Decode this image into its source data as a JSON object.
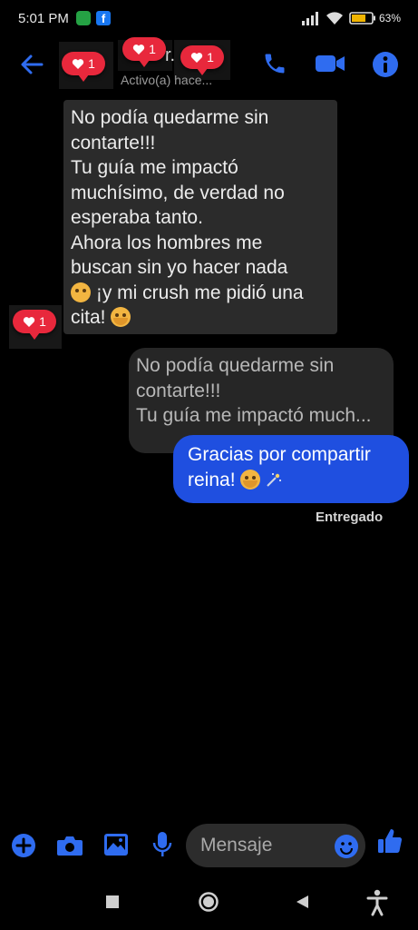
{
  "status_bar": {
    "time": "5:01 PM",
    "battery": "63%",
    "facebook_glyph": "f",
    "icons": [
      "whatsapp-icon",
      "facebook-icon",
      "signal-icon",
      "wifi-icon",
      "battery-icon"
    ]
  },
  "header": {
    "name_fragment": "r.",
    "status_text": "Activo(a) hace...",
    "icons": [
      "back-arrow-icon",
      "phone-icon",
      "video-camera-icon",
      "info-icon"
    ],
    "reaction_badges": [
      "1",
      "1",
      "1"
    ]
  },
  "conversation": {
    "incoming": {
      "lines": [
        "No podía quedarme sin",
        "contarte!!!",
        "Tu guía me impactó",
        "muchísimo, de verdad no",
        "esperaba tanto.",
        "Ahora los hombres me",
        "buscan sin yo hacer nada",
        "¡y mi crush me pidió una",
        "cita!"
      ],
      "reaction_count": "1"
    },
    "reply_quote": {
      "lines": [
        "No podía quedarme sin",
        "contarte!!!",
        "Tu guía me impactó much..."
      ]
    },
    "outgoing": {
      "lines": [
        "Gracias por compartir",
        "reina!"
      ],
      "status": "Entregado"
    }
  },
  "composer": {
    "placeholder": "Mensaje",
    "icons": [
      "plus-icon",
      "camera-icon",
      "image-icon",
      "microphone-icon",
      "emoji-icon",
      "thumbs-up-icon"
    ]
  },
  "nav_bar": {
    "icons": [
      "square-recents-icon",
      "circle-home-icon",
      "triangle-back-icon",
      "accessibility-icon"
    ]
  },
  "colors": {
    "accent": "#1f4fe0",
    "icon_blue": "#2f6cf0",
    "reaction_red": "#e8283c",
    "incoming_bubble": "#2b2b2b",
    "background": "#000000"
  }
}
